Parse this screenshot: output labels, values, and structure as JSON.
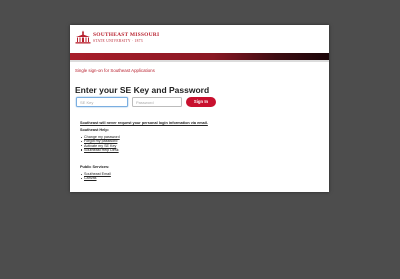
{
  "logo": {
    "line1": "SOUTHEAST MISSOURI",
    "line2": "STATE UNIVERSITY · 1873",
    "icon": "academic-hall-icon"
  },
  "colors": {
    "brand_red": "#c8102e",
    "background": "#4d4d4d",
    "card": "#ffffff"
  },
  "sso_text": "Single sign-on for Southeast Applications",
  "heading": "Enter your SE Key and Password",
  "form": {
    "key_placeholder": "SE Key",
    "password_placeholder": "Password",
    "signin_label": "Sign In"
  },
  "warning": "Southeast will never request your personal login information via email.",
  "help": {
    "title": "Southeast Help:",
    "links": [
      "Change my password",
      "Forgot my password",
      "Activate my SE Key",
      "Southeast Help Desk"
    ]
  },
  "services": {
    "title": "Public Services:",
    "links": [
      "Southeast Email",
      "Canvas"
    ]
  }
}
